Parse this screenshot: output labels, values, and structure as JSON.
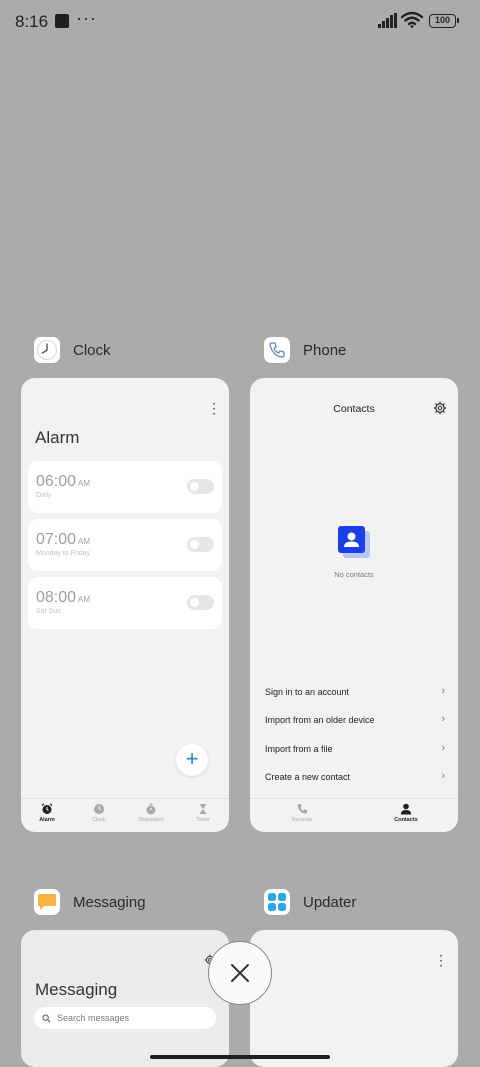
{
  "status_bar": {
    "time": "8:16",
    "more": "···",
    "battery": "100"
  },
  "apps": {
    "clock": {
      "name": "Clock",
      "icon": "clock-icon",
      "screen_title": "Alarm",
      "alarms": [
        {
          "time": "06:00",
          "ampm": "AM",
          "repeat": "Daily",
          "enabled": false
        },
        {
          "time": "07:00",
          "ampm": "AM",
          "repeat": "Monday to Friday",
          "enabled": false
        },
        {
          "time": "08:00",
          "ampm": "AM",
          "repeat": "Sat Sun",
          "enabled": false
        }
      ],
      "fab": "+",
      "nav": [
        "Alarm",
        "Clock",
        "Stopwatch",
        "Timer"
      ],
      "active_nav": "Alarm"
    },
    "phone": {
      "name": "Phone",
      "icon": "phone-icon",
      "screen_title": "Contacts",
      "empty_text": "No contacts",
      "options": [
        "Sign in to an account",
        "Import from an older device",
        "Import from a file",
        "Create a new contact"
      ],
      "nav": [
        "Recents",
        "Contacts"
      ],
      "active_nav": "Contacts"
    },
    "messaging": {
      "name": "Messaging",
      "icon": "messaging-icon",
      "screen_title": "Messaging",
      "search_placeholder": "Search messages"
    },
    "updater": {
      "name": "Updater",
      "icon": "updater-icon"
    }
  },
  "colors": {
    "background": "#ababab",
    "accent_blue": "#2b7fde",
    "contact_blue": "#1a3fe6"
  }
}
